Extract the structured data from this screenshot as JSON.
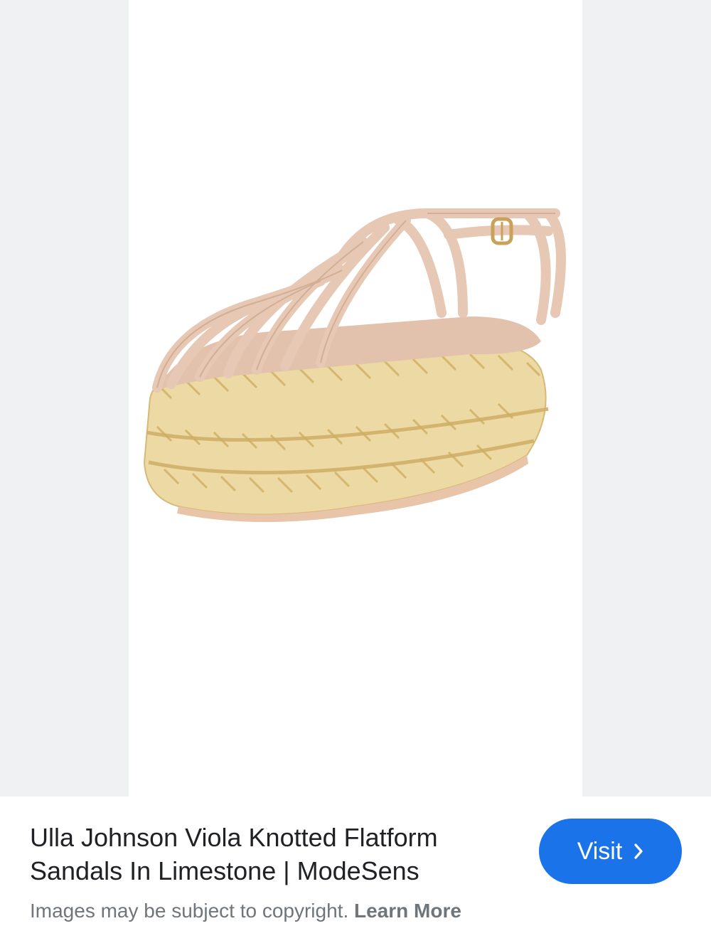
{
  "result": {
    "title_line1": "Ulla Johnson Viola Knotted Flatform",
    "title_line2": "Sandals In Limestone | ModeSens",
    "visit_label": "Visit",
    "copyright_text": "Images may be subject to copyright.",
    "learn_more_label": "Learn More"
  },
  "icons": {
    "visit_chevron": "chevron-right-icon"
  },
  "colors": {
    "accent": "#1a73e8",
    "side_panel": "#f0f1f3",
    "title_text": "#202124",
    "secondary_text": "#70757a"
  }
}
